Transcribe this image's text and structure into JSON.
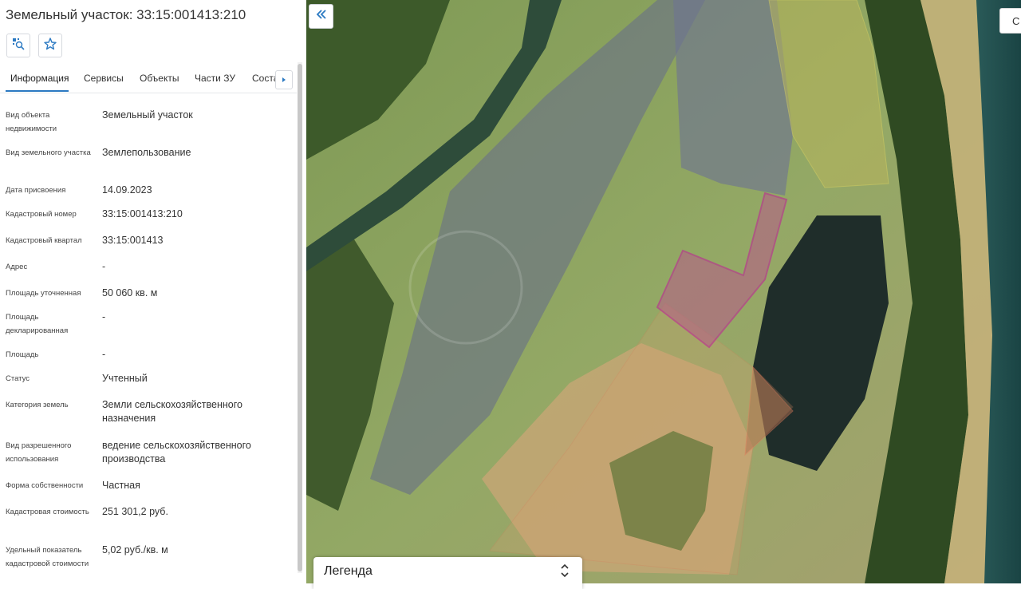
{
  "panel": {
    "title": "Земельный участок: 33:15:001413:210",
    "icons": [
      "map-search-icon",
      "star-icon"
    ],
    "tabs": [
      {
        "label": "Информация",
        "active": true
      },
      {
        "label": "Сервисы",
        "active": false
      },
      {
        "label": "Объекты",
        "active": false
      },
      {
        "label": "Части ЗУ",
        "active": false
      },
      {
        "label": "Соста",
        "active": false
      }
    ],
    "fields": [
      {
        "label": "Вид объекта недвижимости",
        "value": "Земельный участок"
      },
      {
        "label": "Вид земельного участка",
        "value": "Землепользование"
      },
      {
        "label": "Дата присвоения",
        "value": "14.09.2023"
      },
      {
        "label": "Кадастровый номер",
        "value": "33:15:001413:210"
      },
      {
        "label": "Кадастровый квартал",
        "value": "33:15:001413"
      },
      {
        "label": "Адрес",
        "value": "-"
      },
      {
        "label": "Площадь уточненная",
        "value": "50 060 кв. м"
      },
      {
        "label": "Площадь декларированная",
        "value": "-"
      },
      {
        "label": "Площадь",
        "value": "-"
      },
      {
        "label": "Статус",
        "value": "Учтенный"
      },
      {
        "label": "Категория земель",
        "value": "Земли сельскохозяйственного назначения"
      },
      {
        "label": "Вид разрешенного использования",
        "value": "ведение сельскохозяйственного производства"
      },
      {
        "label": "Форма собственности",
        "value": "Частная"
      },
      {
        "label": "Кадастровая стоимость",
        "value": "251 301,2 руб."
      },
      {
        "label": "Удельный показатель кадастровой стоимости",
        "value": "5,02 руб./кв. м"
      }
    ]
  },
  "map": {
    "legend_label": "Легенда",
    "top_right_button": "С",
    "colors": {
      "selected_parcel": "#c2189a",
      "parcel_outline": "#e07a5a",
      "water": "#1f2d2a",
      "river": "#1e4a4a",
      "field": "#7f9a55",
      "forest": "#2f4a22"
    }
  }
}
